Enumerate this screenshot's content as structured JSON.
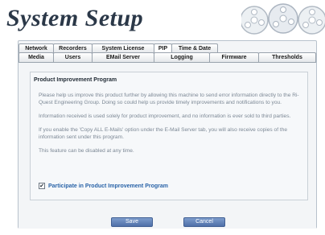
{
  "header": {
    "title": "System Setup"
  },
  "tabs": {
    "row1": [
      {
        "label": "Network"
      },
      {
        "label": "Recorders"
      },
      {
        "label": "System License"
      },
      {
        "label": "PIP"
      },
      {
        "label": "Time & Date"
      }
    ],
    "row2": [
      {
        "label": "Media"
      },
      {
        "label": "Users"
      },
      {
        "label": "EMail Server"
      },
      {
        "label": "Logging"
      },
      {
        "label": "Firmware"
      },
      {
        "label": "Thresholds"
      }
    ],
    "active": "PIP"
  },
  "section": {
    "title": "Product Improvement Program",
    "paragraphs": [
      "Please help us improve this product further by allowing this machine to send error information directly to the Ri-Quest Engineering Group. Doing so could help us provide timely improvements and notifications to you.",
      "Information received is used solely for product improvement, and no information is ever sold to third parties.",
      "If you enable the 'Copy ALL E-Mails' option under the E-Mail Server tab, you will also receive copies of the information sent under this program.",
      "This feature can be disabled at any time."
    ],
    "checkbox": {
      "label": "Participate in Product Improvement Program",
      "checked": true,
      "mark": "✔"
    }
  },
  "buttons": {
    "save": "Save",
    "cancel": "Cancel"
  },
  "colors": {
    "accent": "#2a64a8",
    "button": "#5f7fb5",
    "title": "#2b3848"
  },
  "icons": {
    "header_graphic": "film-reels-icon"
  }
}
